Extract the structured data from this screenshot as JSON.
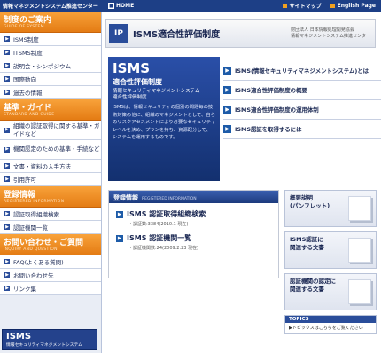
{
  "topbar": {
    "brand": "情報マネジメントシステム推進センター",
    "home": "HOME",
    "sitemap": "サイトマップ",
    "english": "English Page"
  },
  "sidebar": {
    "system_head": {
      "jp": "制度のご案内",
      "en": "GUIDE OF SYSTEM"
    },
    "system_items": [
      "ISMS制度",
      "ITSMS制度",
      "説明会・シンポジウム",
      "国際動向",
      "過去の情報"
    ],
    "standard_head": {
      "jp": "基準・ガイド",
      "en": "STANDARD AND GUIDE"
    },
    "standard_items": [
      "組織の認証取得に関する基準・ガイドなど",
      "機関認定のための基準・手続など",
      "文書・資料の入手方法",
      "引用許可"
    ],
    "register_head": {
      "jp": "登録情報",
      "en": "REGISTERED INFORMATION"
    },
    "register_items": [
      "認証取得組織検索",
      "認証機関一覧"
    ],
    "inquiry_head": {
      "jp": "お問い合わせ・ご質問",
      "en": "INQUIRY AND QUESTION"
    },
    "inquiry_items": [
      "FAQ(よくある質問)",
      "お問い合わせ先",
      "リンク集"
    ],
    "badge": {
      "big": "ISMS",
      "small": "情報セキュリティマネジメントシステム"
    }
  },
  "header": {
    "logo": "IP",
    "title": "ISMS適合性評価制度",
    "org_line1": "財団法人 日本情報処理開発協会",
    "org_line2": "情報マネジメントシステム推進センター"
  },
  "hero": {
    "title": "ISMS",
    "subtitle": "適合性評価制度",
    "tagline1": "情報セキュリティマネジメントシステム",
    "tagline2": "適合性評価制度",
    "body": "ISMSは、情報セキュリティの個別の問題毎の技術対策の他に、組織のマネジメントとして、自らのリスクアセスメントにより必要なセキュリティレベルを決め、プランを持ち、資源配分して、システムを運用するものです。"
  },
  "links": [
    "ISMS(情報セキュリティマネジメントシステム)とは",
    "ISMS適合性評価制度の概要",
    "ISMS適合性評価制度の運用体制",
    "ISMS認証を取得するには"
  ],
  "registered": {
    "head_jp": "登録情報",
    "head_en": "REGISTERED INFORMATION",
    "rows": [
      {
        "title": "ISMS 認証取得組織検索",
        "caption": "・認証数:3384(2010.1 現在)"
      },
      {
        "title": "ISMS 認証機関一覧",
        "caption": "・認証機関数:24(2009.2.23 現在)"
      }
    ]
  },
  "cards": [
    {
      "label1": "概要説明",
      "label2": "(パンフレット)"
    },
    {
      "label1": "ISMS認証に",
      "label2": "関連する文書"
    },
    {
      "label1": "認証機関の認定に",
      "label2": "関連する文書"
    }
  ],
  "topics": {
    "head": "TOPICS",
    "text": "▶トピックスはこちらをご覧ください"
  }
}
